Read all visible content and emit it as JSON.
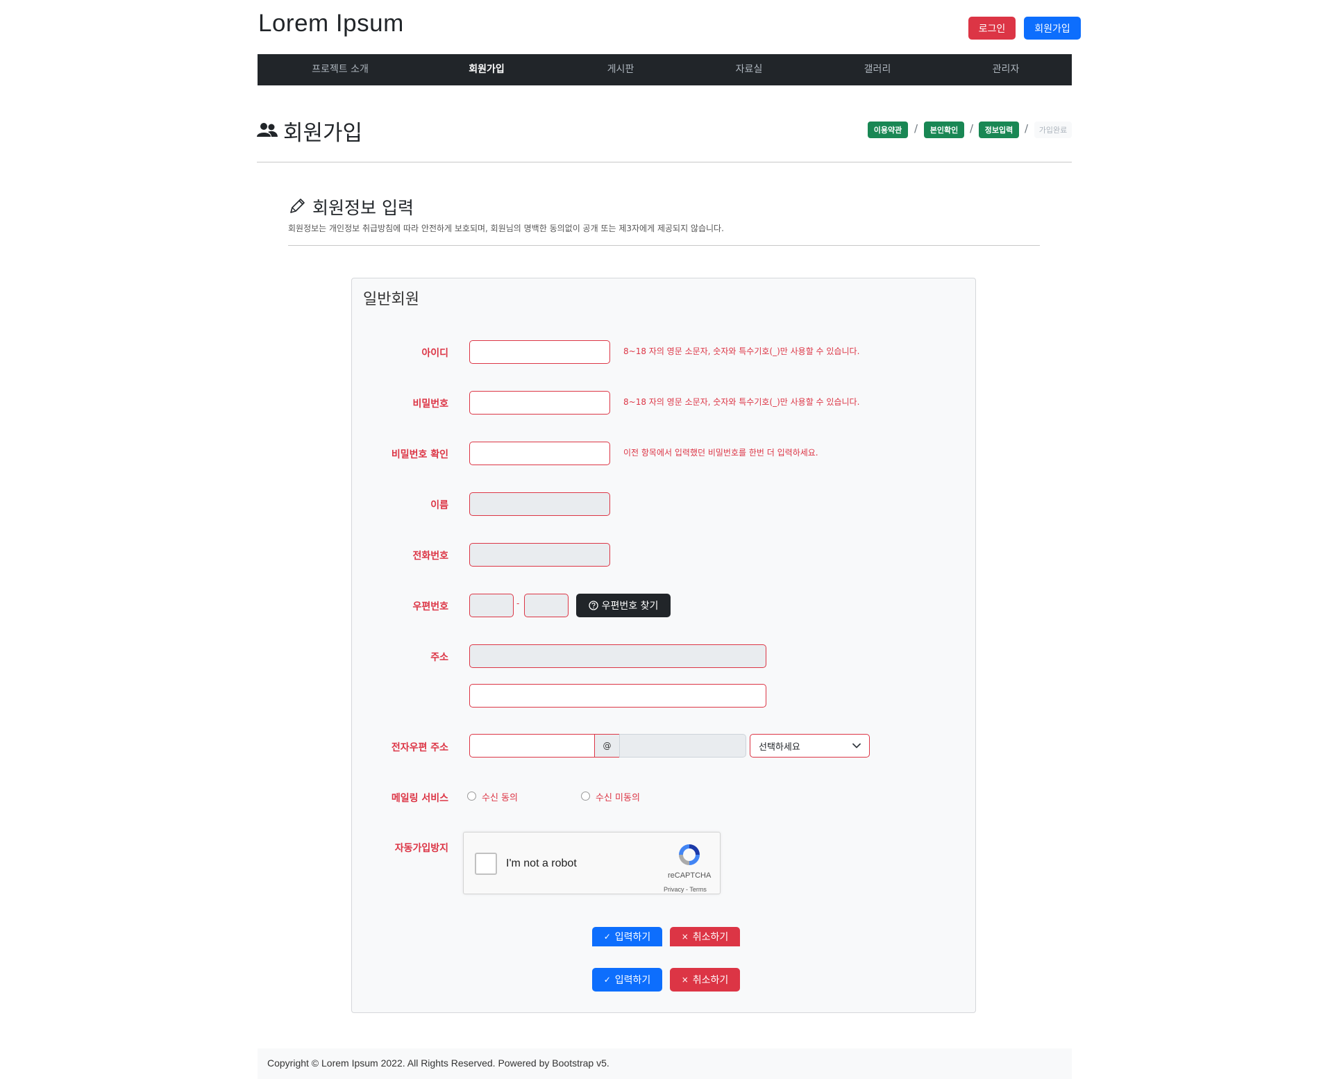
{
  "header": {
    "brand": "Lorem Ipsum",
    "login_label": "로그인",
    "signup_label": "회원가입"
  },
  "nav": {
    "items": [
      {
        "label": "프로젝트 소개"
      },
      {
        "label": "회원가입"
      },
      {
        "label": "게시판"
      },
      {
        "label": "자료실"
      },
      {
        "label": "갤러리"
      },
      {
        "label": "관리자"
      }
    ]
  },
  "page": {
    "title": "회원가입",
    "breadcrumb": [
      "이용약관",
      "본인확인",
      "정보입력",
      "가입완료"
    ],
    "breadcrumb_separator": "/"
  },
  "section": {
    "title": "회원정보 입력",
    "description": "회원정보는 개인정보 취급방침에 따라 안전하게 보호되며, 회원님의 명백한 동의없이 공개 또는 제3자에게 제공되지 않습니다."
  },
  "form": {
    "card_title": "일반회원",
    "id_label": "아이디",
    "id_help": "8~18 자의 영문 소문자, 숫자와 특수기호(_)만 사용할 수 있습니다.",
    "password_label": "비밀번호",
    "password_help": "8~18 자의 영문 소문자, 숫자와 특수기호(_)만 사용할 수 있습니다.",
    "password_confirm_label": "비밀번호 확인",
    "password_confirm_help": "이전 항목에서 입력했던 비밀번호를 한번 더 입력하세요.",
    "name_label": "이름",
    "phone_label": "전화번호",
    "zip_label": "우편번호",
    "zip_separator": "-",
    "zip_button": "우편번호 찾기",
    "address_label": "주소",
    "email_label": "전자우편 주소",
    "email_at": "@",
    "email_domain_select": "선택하세요",
    "mailing_label": "메일링 서비스",
    "mailing_agree": "수신 동의",
    "mailing_disagree": "수신 미동의",
    "captcha_label": "자동가입방지",
    "captcha_text": "I'm not a robot",
    "captcha_brand": "reCAPTCHA",
    "captcha_terms": "Privacy - Terms",
    "submit_label": "입력하기",
    "cancel_label": "취소하기"
  },
  "footer": {
    "text": "Copyright © Lorem Ipsum 2022. All Rights Reserved. Powered by Bootstrap v5."
  },
  "colors": {
    "danger": "#dc3545",
    "primary": "#0d6efd",
    "dark": "#212529",
    "success": "#198754"
  },
  "icons": [
    "users-icon",
    "pencil-icon",
    "question-circle-icon",
    "check-icon",
    "x-icon",
    "chevron-down-icon",
    "recaptcha-icon"
  ]
}
